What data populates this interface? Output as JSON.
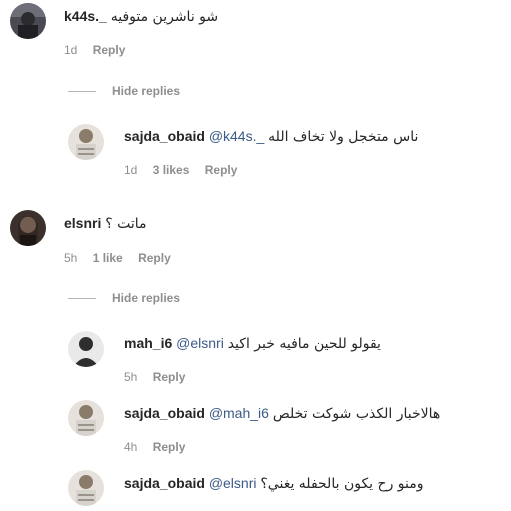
{
  "comments": [
    {
      "username": "k44s._",
      "mention": "",
      "text": "شو ناشرين متوفيه",
      "time": "1d",
      "likes": "",
      "reply": "Reply"
    },
    {
      "username": "sajda_obaid",
      "mention": "@k44s._",
      "text": "ناس متخجل ولا تخاف الله",
      "time": "1d",
      "likes": "3 likes",
      "reply": "Reply"
    },
    {
      "username": "elsnri",
      "mention": "",
      "text": "ماتت ؟",
      "time": "5h",
      "likes": "1 like",
      "reply": "Reply"
    },
    {
      "username": "mah_i6",
      "mention": "@elsnri",
      "text": "يقولو للحين مافيه خبر اكيد",
      "time": "5h",
      "likes": "",
      "reply": "Reply"
    },
    {
      "username": "sajda_obaid",
      "mention": "@mah_i6",
      "text": "هالاخبار الكذب شوكت تخلص",
      "time": "4h",
      "likes": "",
      "reply": "Reply"
    },
    {
      "username": "sajda_obaid",
      "mention": "@elsnri",
      "text": "ومنو رح يكون بالحفله يغني؟",
      "time": "",
      "likes": "",
      "reply": ""
    }
  ],
  "hide_replies_label": "Hide replies",
  "avatar_colors": {
    "k44s": "#3a3a40",
    "sajda": "#cfc8be",
    "elsnri": "#2a2422",
    "mah": "#5a5a5a"
  }
}
